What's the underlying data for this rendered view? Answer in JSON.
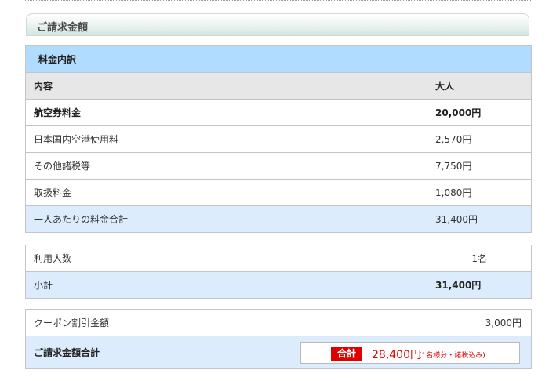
{
  "section_title": "ご請求金額",
  "breakdown": {
    "title": "料金内訳",
    "header": {
      "content": "内容",
      "adult": "大人"
    },
    "rows": [
      {
        "label": "航空券料金",
        "value": "20,000円",
        "bold": true
      },
      {
        "label": "日本国内空港使用料",
        "value": "2,570円"
      },
      {
        "label": "その他諸税等",
        "value": "7,750円"
      },
      {
        "label": "取扱料金",
        "value": "1,080円"
      }
    ],
    "per_person_total": {
      "label": "一人あたりの料金合計",
      "value": "31,400円"
    }
  },
  "people": {
    "count_label": "利用人数",
    "count_value": "1名",
    "subtotal_label": "小計",
    "subtotal_value": "31,400円"
  },
  "coupon": {
    "label": "クーポン割引金額",
    "value": "3,000円"
  },
  "grand_total": {
    "label": "ご請求金額合計",
    "tag": "合計",
    "amount": "28,400円",
    "note": "(1名様分・諸税込み)"
  },
  "colors": {
    "title_row_bg": "#b0dcff",
    "sum_row_bg": "#dcecfc",
    "header_row_bg": "#e7e7e7",
    "total_accent": "#e00000"
  }
}
